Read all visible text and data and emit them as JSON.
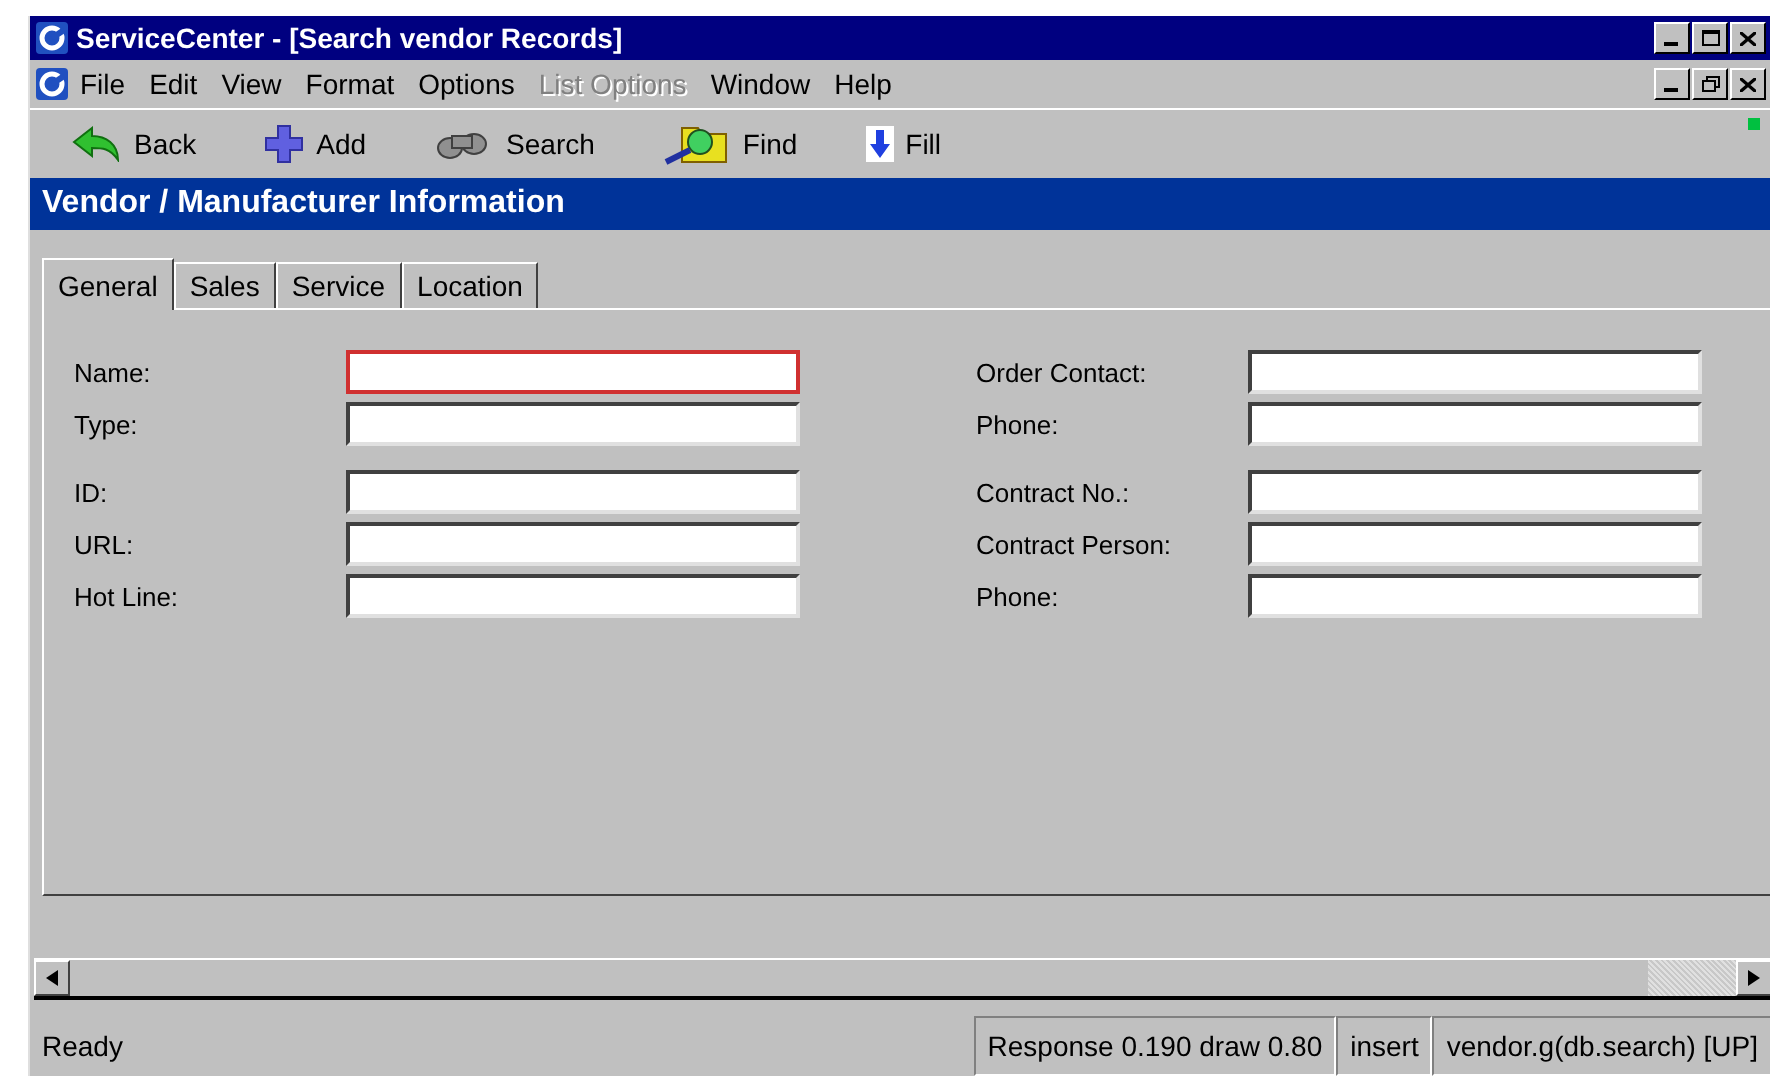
{
  "window": {
    "title": "ServiceCenter - [Search vendor Records]"
  },
  "menu": [
    {
      "label": "File",
      "disabled": false
    },
    {
      "label": "Edit",
      "disabled": false
    },
    {
      "label": "View",
      "disabled": false
    },
    {
      "label": "Format",
      "disabled": false
    },
    {
      "label": "Options",
      "disabled": false
    },
    {
      "label": "List Options",
      "disabled": true
    },
    {
      "label": "Window",
      "disabled": false
    },
    {
      "label": "Help",
      "disabled": false
    }
  ],
  "toolbar": [
    {
      "label": "Back",
      "kind": "back"
    },
    {
      "label": "Add",
      "kind": "add"
    },
    {
      "label": "Search",
      "kind": "search"
    },
    {
      "label": "Find",
      "kind": "find"
    },
    {
      "label": "Fill",
      "kind": "fill"
    }
  ],
  "header": "Vendor / Manufacturer Information",
  "tabs": [
    {
      "label": "General",
      "selected": true
    },
    {
      "label": "Sales",
      "selected": false
    },
    {
      "label": "Service",
      "selected": false
    },
    {
      "label": "Location",
      "selected": false
    }
  ],
  "left_fields": [
    [
      {
        "label": "Name:",
        "focused": true
      },
      {
        "label": "Type:",
        "focused": false
      }
    ],
    [
      {
        "label": "ID:",
        "focused": false
      },
      {
        "label": "URL:",
        "focused": false
      },
      {
        "label": "Hot Line:",
        "focused": false
      }
    ]
  ],
  "right_fields": [
    [
      {
        "label": "Order Contact:",
        "focused": false
      },
      {
        "label": "Phone:",
        "focused": false
      }
    ],
    [
      {
        "label": "Contract No.:",
        "focused": false
      },
      {
        "label": "Contract Person:",
        "focused": false
      },
      {
        "label": "Phone:",
        "focused": false
      }
    ]
  ],
  "status_bar": [
    "Ready",
    "Response 0.190 draw 0.80",
    "insert",
    "vendor.g(db.search) [UP]"
  ]
}
